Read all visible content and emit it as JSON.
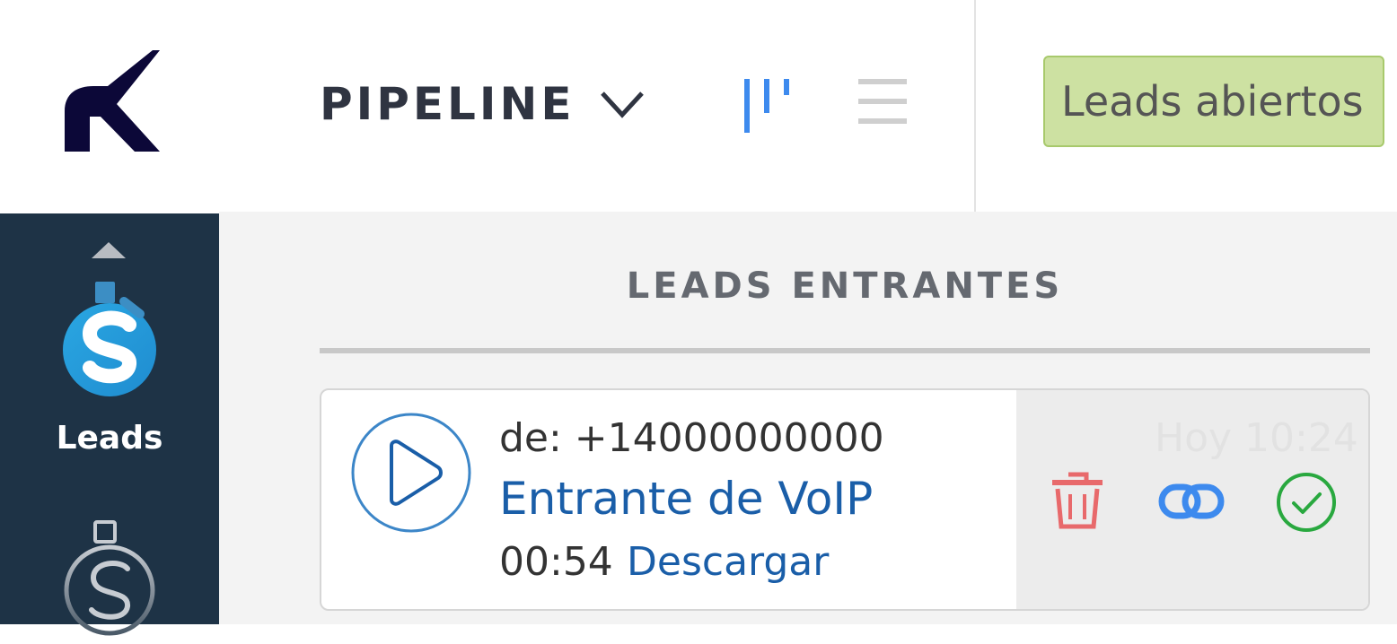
{
  "header": {
    "logo_icon": "k-logo-icon",
    "pipeline_label": "PIPELINE",
    "view_icons": [
      "board-view-icon",
      "list-view-icon"
    ],
    "filter_button_label": "Leads abiertos"
  },
  "sidebar": {
    "items": [
      {
        "label": "Leads",
        "icon": "leads-dollar-icon",
        "active": true
      },
      {
        "label": "",
        "icon": "deals-dollar-icon",
        "active": false
      }
    ]
  },
  "board": {
    "column_title": "LEADS ENTRANTES",
    "cards": [
      {
        "from": "de: +14000000000",
        "title": "Entrante de VoIP",
        "duration": "00:54",
        "download_label": "Descargar",
        "timestamp": "Hoy 10:24",
        "actions": [
          "delete",
          "link",
          "accept"
        ]
      }
    ]
  },
  "colors": {
    "sidebar_bg": "#1e3346",
    "filter_button_bg": "#cde1a2",
    "link_blue": "#1a5ea8",
    "delete_red": "#e8696b",
    "link_icon_blue": "#3d8aee",
    "accept_green": "#29a83f"
  }
}
